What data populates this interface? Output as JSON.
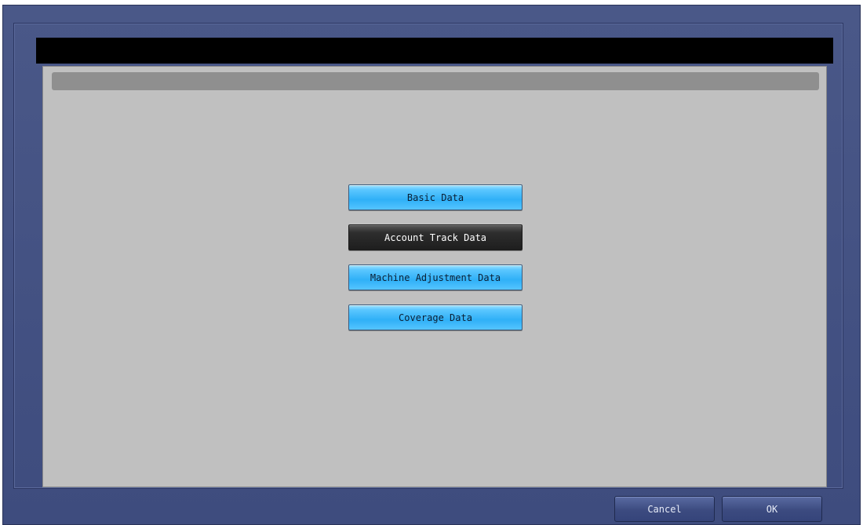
{
  "menu": {
    "buttons": [
      {
        "label": "Basic Data",
        "selected": false
      },
      {
        "label": "Account Track Data",
        "selected": true
      },
      {
        "label": "Machine Adjustment Data",
        "selected": false
      },
      {
        "label": "Coverage Data",
        "selected": false
      }
    ]
  },
  "footer": {
    "cancel_label": "Cancel",
    "ok_label": "OK"
  },
  "colors": {
    "frame": "#4a5888",
    "button_blue": "#2fb0f7",
    "button_selected": "#1e1e1e",
    "panel": "#c0c0c0"
  }
}
